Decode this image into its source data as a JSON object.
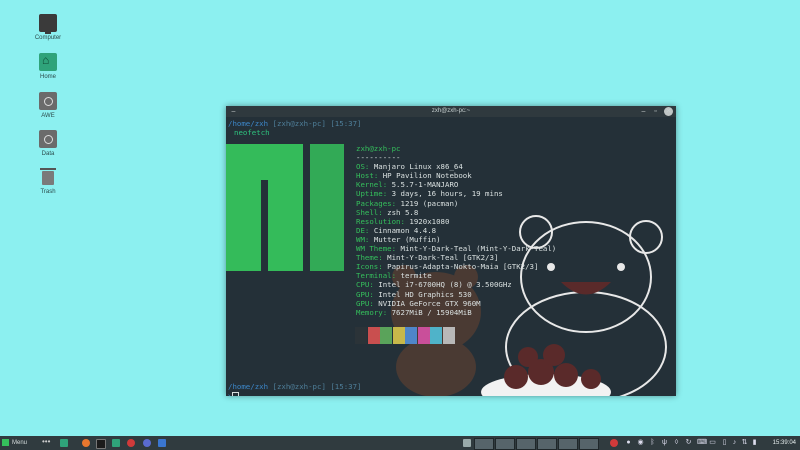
{
  "desktop": {
    "icons": [
      {
        "label": "Computer",
        "icon": "computer-icon"
      },
      {
        "label": "Home",
        "icon": "home-folder-icon"
      },
      {
        "label": "AWE",
        "icon": "drive-icon"
      },
      {
        "label": "Data",
        "icon": "drive-icon"
      },
      {
        "label": "Trash",
        "icon": "trash-icon"
      }
    ],
    "background_color": "#8cf0f0"
  },
  "terminal": {
    "title": "zxh@zxh-pc:~",
    "prompt_path": "/home/zxh",
    "prompt_host": "[zxh@zxh-pc]",
    "prompt_time": "[15:37]",
    "command": "neofetch",
    "prompt_time_2": "[15:37]",
    "user_host": "zxh@zxh-pc",
    "separator": "----------",
    "info": [
      {
        "key": "OS",
        "value": "Manjaro Linux x86_64"
      },
      {
        "key": "Host",
        "value": "HP Pavilion Notebook"
      },
      {
        "key": "Kernel",
        "value": "5.5.7-1-MANJARO"
      },
      {
        "key": "Uptime",
        "value": "3 days, 16 hours, 19 mins"
      },
      {
        "key": "Packages",
        "value": "1219 (pacman)"
      },
      {
        "key": "Shell",
        "value": "zsh 5.8"
      },
      {
        "key": "Resolution",
        "value": "1920x1080"
      },
      {
        "key": "DE",
        "value": "Cinnamon 4.4.8"
      },
      {
        "key": "WM",
        "value": "Mutter (Muffin)"
      },
      {
        "key": "WM Theme",
        "value": "Mint-Y-Dark-Teal (Mint-Y-Dark-Teal)"
      },
      {
        "key": "Theme",
        "value": "Mint-Y-Dark-Teal [GTK2/3]"
      },
      {
        "key": "Icons",
        "value": "Papirus-Adapta-Nokto-Maia [GTK2/3]"
      },
      {
        "key": "Terminal",
        "value": "termite"
      },
      {
        "key": "CPU",
        "value": "Intel i7-6700HQ (8) @ 3.500GHz"
      },
      {
        "key": "GPU",
        "value": "Intel HD Graphics 530"
      },
      {
        "key": "GPU",
        "value": "NVIDIA GeForce GTX 960M"
      },
      {
        "key": "Memory",
        "value": "7627MiB / 15904MiB"
      }
    ],
    "palette": [
      "#2b3338",
      "#c94f4f",
      "#5aa35a",
      "#c8b84a",
      "#4f86c9",
      "#c94f9a",
      "#4fb3c9",
      "#b8b8b8"
    ],
    "accent_color": "#35bf5c"
  },
  "taskbar": {
    "menu_label": "Menu",
    "clock": "15:39:04"
  }
}
